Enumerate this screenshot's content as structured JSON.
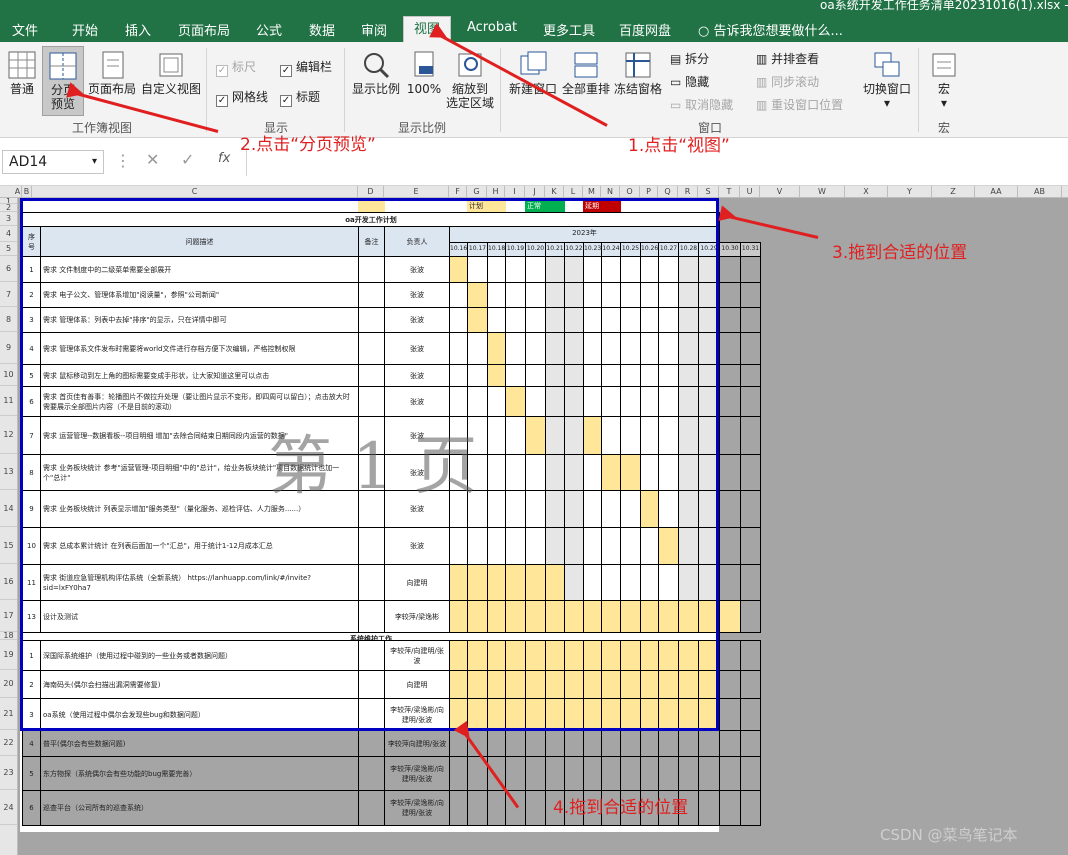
{
  "window": {
    "title": "oa系统开发工作任务清单20231016(1).xlsx - E"
  },
  "menu": [
    "文件",
    "开始",
    "插入",
    "页面布局",
    "公式",
    "数据",
    "审阅",
    "视图",
    "Acrobat",
    "更多工具",
    "百度网盘"
  ],
  "tell_me": "告诉我您想要做什么...",
  "ribbon": {
    "workbook_views": {
      "label": "工作簿视图",
      "normal": "普通",
      "page_break_1": "分页",
      "page_break_2": "预览",
      "page_layout": "页面布局",
      "custom_view": "自定义视图"
    },
    "show": {
      "label": "显示",
      "ruler": "标尺",
      "formula_bar": "编辑栏",
      "gridlines": "网格线",
      "headings": "标题"
    },
    "zoom": {
      "label": "显示比例",
      "zoom": "显示比例",
      "zoom100": "100%",
      "zoom_sel_1": "缩放到",
      "zoom_sel_2": "选定区域"
    },
    "window": {
      "label": "窗口",
      "new": "新建窗口",
      "arrange": "全部重排",
      "freeze": "冻结窗格",
      "split": "拆分",
      "hide": "隐藏",
      "unhide": "取消隐藏",
      "side_by_side": "并排查看",
      "sync_scroll": "同步滚动",
      "reset_pos": "重设窗口位置",
      "switch": "切换窗口"
    },
    "macros": {
      "label": "宏",
      "macro": "宏"
    }
  },
  "formula": {
    "namebox": "AD14",
    "fx": "fx"
  },
  "columns": [
    "A",
    "B",
    "C",
    "D",
    "E",
    "F",
    "G",
    "H",
    "I",
    "J",
    "K",
    "L",
    "M",
    "N",
    "O",
    "P",
    "Q",
    "R",
    "S",
    "T",
    "U",
    "V",
    "W",
    "X",
    "Y",
    "Z",
    "AA",
    "AB"
  ],
  "rows": [
    "1",
    "2",
    "3",
    "4",
    "5",
    "6",
    "7",
    "8",
    "9",
    "10",
    "11",
    "12",
    "13",
    "14",
    "15",
    "16",
    "17",
    "18",
    "19",
    "20",
    "21",
    "22",
    "23",
    "24"
  ],
  "legend": {
    "plan": "计划",
    "normal": "正常",
    "delay": "延期"
  },
  "sheet_title": "oa开发工作计划",
  "headers": {
    "seq": "序号",
    "desc": "问题描述",
    "note": "备注",
    "owner": "负责人",
    "year": "2023年"
  },
  "dates": [
    "10.16",
    "10.17",
    "10.18",
    "10.19",
    "10.20",
    "10.21",
    "10.22",
    "10.23",
    "10.24",
    "10.25",
    "10.26",
    "10.27",
    "10.28",
    "10.29",
    "10.30",
    "10.31"
  ],
  "tasks": [
    {
      "seq": "1",
      "desc": "需求 文件制度中的二级菜单需要全部展开",
      "owner": "张波"
    },
    {
      "seq": "2",
      "desc": "需求 电子公文、管理体系增加\"阅读量\"，参照\"公司新闻\"",
      "owner": "张波"
    },
    {
      "seq": "3",
      "desc": "需求 管理体系：列表中去掉\"排序\"的显示，只在详情中即可",
      "owner": "张波"
    },
    {
      "seq": "4",
      "desc": "需求 管理体系文件发布时需要将world文件进行存档方便下次编辑，严格控制权限",
      "owner": "张波"
    },
    {
      "seq": "5",
      "desc": "需求 鼠标移动到左上角的图标需要变成手形状，让大家知道这里可以点击",
      "owner": "张波"
    },
    {
      "seq": "6",
      "desc": "需求 首页佳有善事：轮播图片不做拉升处理（要让图片显示不变形，即四周可以留白）；点击放大时需要展示全部图片内容（不是目前的滚动）",
      "owner": "张波"
    },
    {
      "seq": "7",
      "desc": "需求 运营管理--数据看板--项目明细 增加\"去除合同结束日期同段内运营的数据\"",
      "owner": "张波"
    },
    {
      "seq": "8",
      "desc": "需求 业务板块统计 参考\"运营管理-项目明细\"中的\"总计\"，给业务板块统计\"项目数据统计也加一个\"总计\"",
      "owner": "张波"
    },
    {
      "seq": "9",
      "desc": "需求 业务板块统计 列表显示增加\"服务类型\"（量化服务、巡检评估、人力服务......）",
      "owner": "张波"
    },
    {
      "seq": "10",
      "desc": "需求 总成本累计统计 在列表后面加一个\"汇总\"，用于统计1-12月成本汇总",
      "owner": "张波"
    },
    {
      "seq": "11",
      "desc": "需求 街道应急管理机构评估系统（全新系统） https://lanhuapp.com/link/#/invite?sid=lxFY0ha7",
      "owner": "向建明"
    },
    {
      "seq": "13",
      "desc": "设计及测试",
      "owner": "李较萍/梁逸彬"
    }
  ],
  "maint_title": "系统维护工作",
  "maint": [
    {
      "seq": "1",
      "desc": "深国际系统维护（使用过程中碰到的一些业务或者数据问题）",
      "owner": "李较萍/向建明/张波"
    },
    {
      "seq": "2",
      "desc": "海南码头(偶尔会扫描出漏洞需要修复)",
      "owner": "向建明"
    },
    {
      "seq": "3",
      "desc": "oa系统（使用过程中偶尔会发现些bug和数据问题）",
      "owner": "李较萍/梁逸彬/向建明/张波"
    },
    {
      "seq": "4",
      "desc": "普平(偶尔会有些数据问题)",
      "owner": "李较萍向建明/张波"
    },
    {
      "seq": "5",
      "desc": "东方物探（系统偶尔会有些功能的bug需要完善）",
      "owner": "李较萍/梁逸彬/向建明/张波"
    },
    {
      "seq": "6",
      "desc": "巡查平台（公司所有的巡查系统）",
      "owner": "李较萍/梁逸彬/向建明/张波"
    }
  ],
  "watermark": "第 1 页",
  "annotations": {
    "a1": "1.点击“视图”",
    "a2": "2.点击“分页预览”",
    "a3": "3.拖到合适的位置",
    "a4": "4.拖到合适的位置"
  },
  "credit": "CSDN @菜鸟笔记本",
  "colors": {
    "excel_green": "#217346",
    "plan": "#ffe699",
    "normal": "#00b050",
    "delay": "#c00000",
    "annotation": "#e02020",
    "page_border": "#0000c0"
  }
}
